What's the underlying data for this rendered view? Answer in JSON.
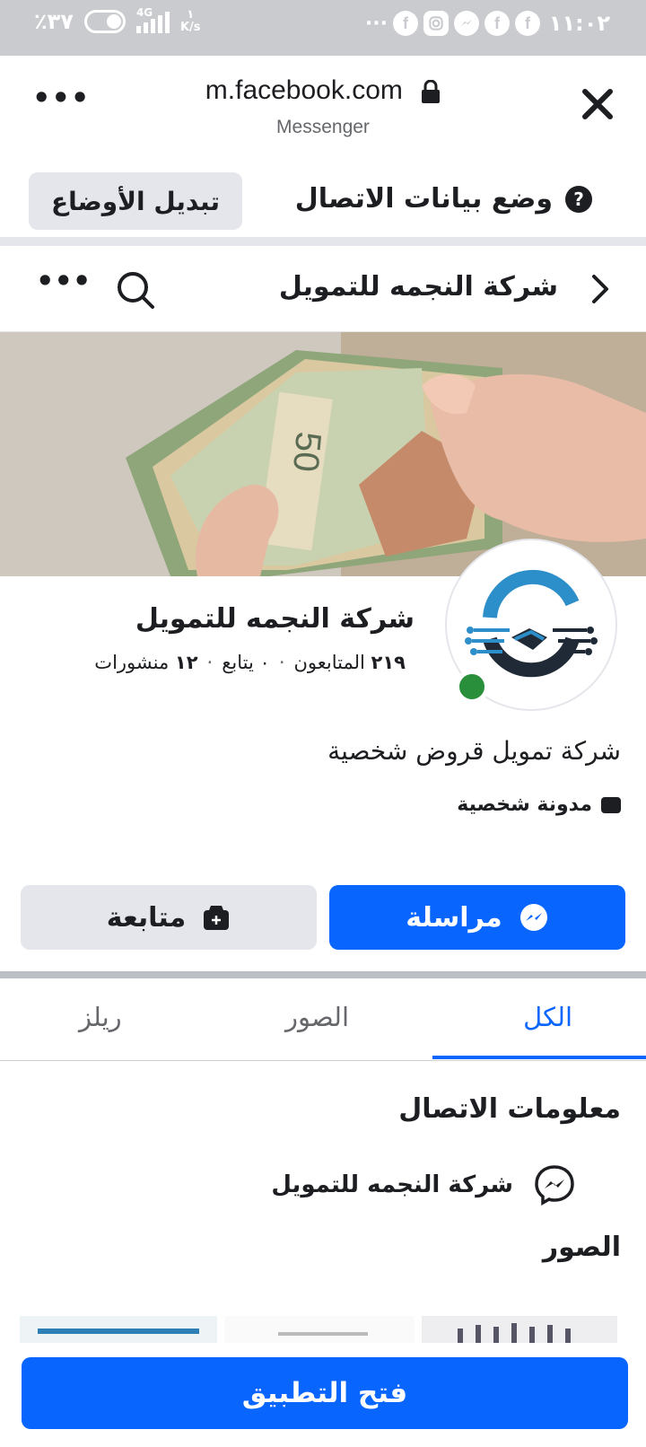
{
  "status_bar": {
    "time": "١١:٠٢",
    "battery": "٪٣٧",
    "network": "4G",
    "speed_top": "١",
    "speed_unit": "K/s",
    "app_icons": [
      "facebook-icon",
      "facebook-icon",
      "messenger-icon",
      "instagram-icon",
      "facebook-icon"
    ],
    "more": "···"
  },
  "browser": {
    "url": "m.facebook.com",
    "subtitle": "Messenger"
  },
  "data_mode": {
    "switch_label": "تبديل الأوضاع",
    "mode_label": "وضع بيانات الاتصال",
    "help": "?"
  },
  "page_header": {
    "title": "شركة النجمه للتمويل"
  },
  "profile": {
    "name": "شركة النجمه للتمويل",
    "followers_count": "٢١٩",
    "followers_label": "المتابعون",
    "following_count": "٠",
    "following_label": "يتابع",
    "posts_count": "١٢",
    "posts_label": "منشورات",
    "bio": "شركة تمويل قروض شخصية",
    "category": "مدونة شخصية"
  },
  "actions": {
    "message": "مراسلة",
    "follow": "متابعة"
  },
  "tabs": [
    {
      "label": "الكل",
      "active": true
    },
    {
      "label": "الصور",
      "active": false
    },
    {
      "label": "ريلز",
      "active": false
    }
  ],
  "contact": {
    "title": "معلومات الاتصال",
    "messenger_name": "شركة النجمه للتمويل"
  },
  "photos": {
    "title": "الصور"
  },
  "open_app": "فتح التطبيق",
  "colors": {
    "accent": "#0866ff",
    "status_bar": "#c9cbcf",
    "online": "#2a8f3b",
    "button_grey": "#e4e6eb"
  }
}
